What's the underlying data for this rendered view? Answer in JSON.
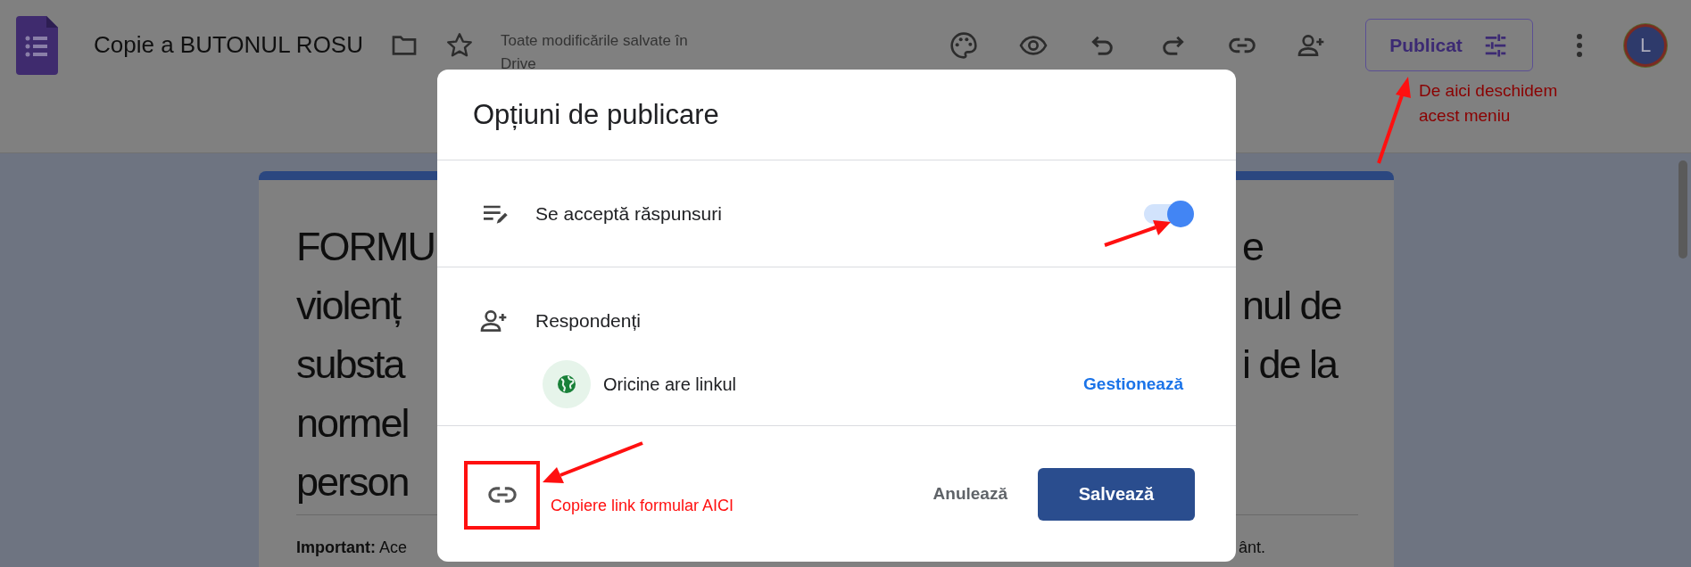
{
  "header": {
    "title": "Copie a BUTONUL ROSU",
    "save_status": "Toate modificările salvate în Drive",
    "publish_button": "Publicat",
    "avatar_letter": "L"
  },
  "form_card": {
    "title_lines": [
      {
        "left": "FORMU",
        "right": "e"
      },
      {
        "left": "violenț",
        "right": "nul de"
      },
      {
        "left": "substa",
        "right": "i de la"
      },
      {
        "left": "normel"
      },
      {
        "left": "person"
      }
    ],
    "note": {
      "left": "**Important:** Ace",
      "right": "ânt."
    }
  },
  "dialog": {
    "title": "Opțiuni de publicare",
    "accept_responses": {
      "label": "Se acceptă răspunsuri",
      "on": true
    },
    "respondents": {
      "label": "Respondenți",
      "access": "Oricine are linkul",
      "manage_link": "Gestionează"
    },
    "cancel_button": "Anulează",
    "save_button": "Salvează"
  },
  "annotations": [
    {
      "text": "De aici deschidem acest meniu"
    },
    {
      "text": "Copiere link formular AICI"
    }
  ]
}
